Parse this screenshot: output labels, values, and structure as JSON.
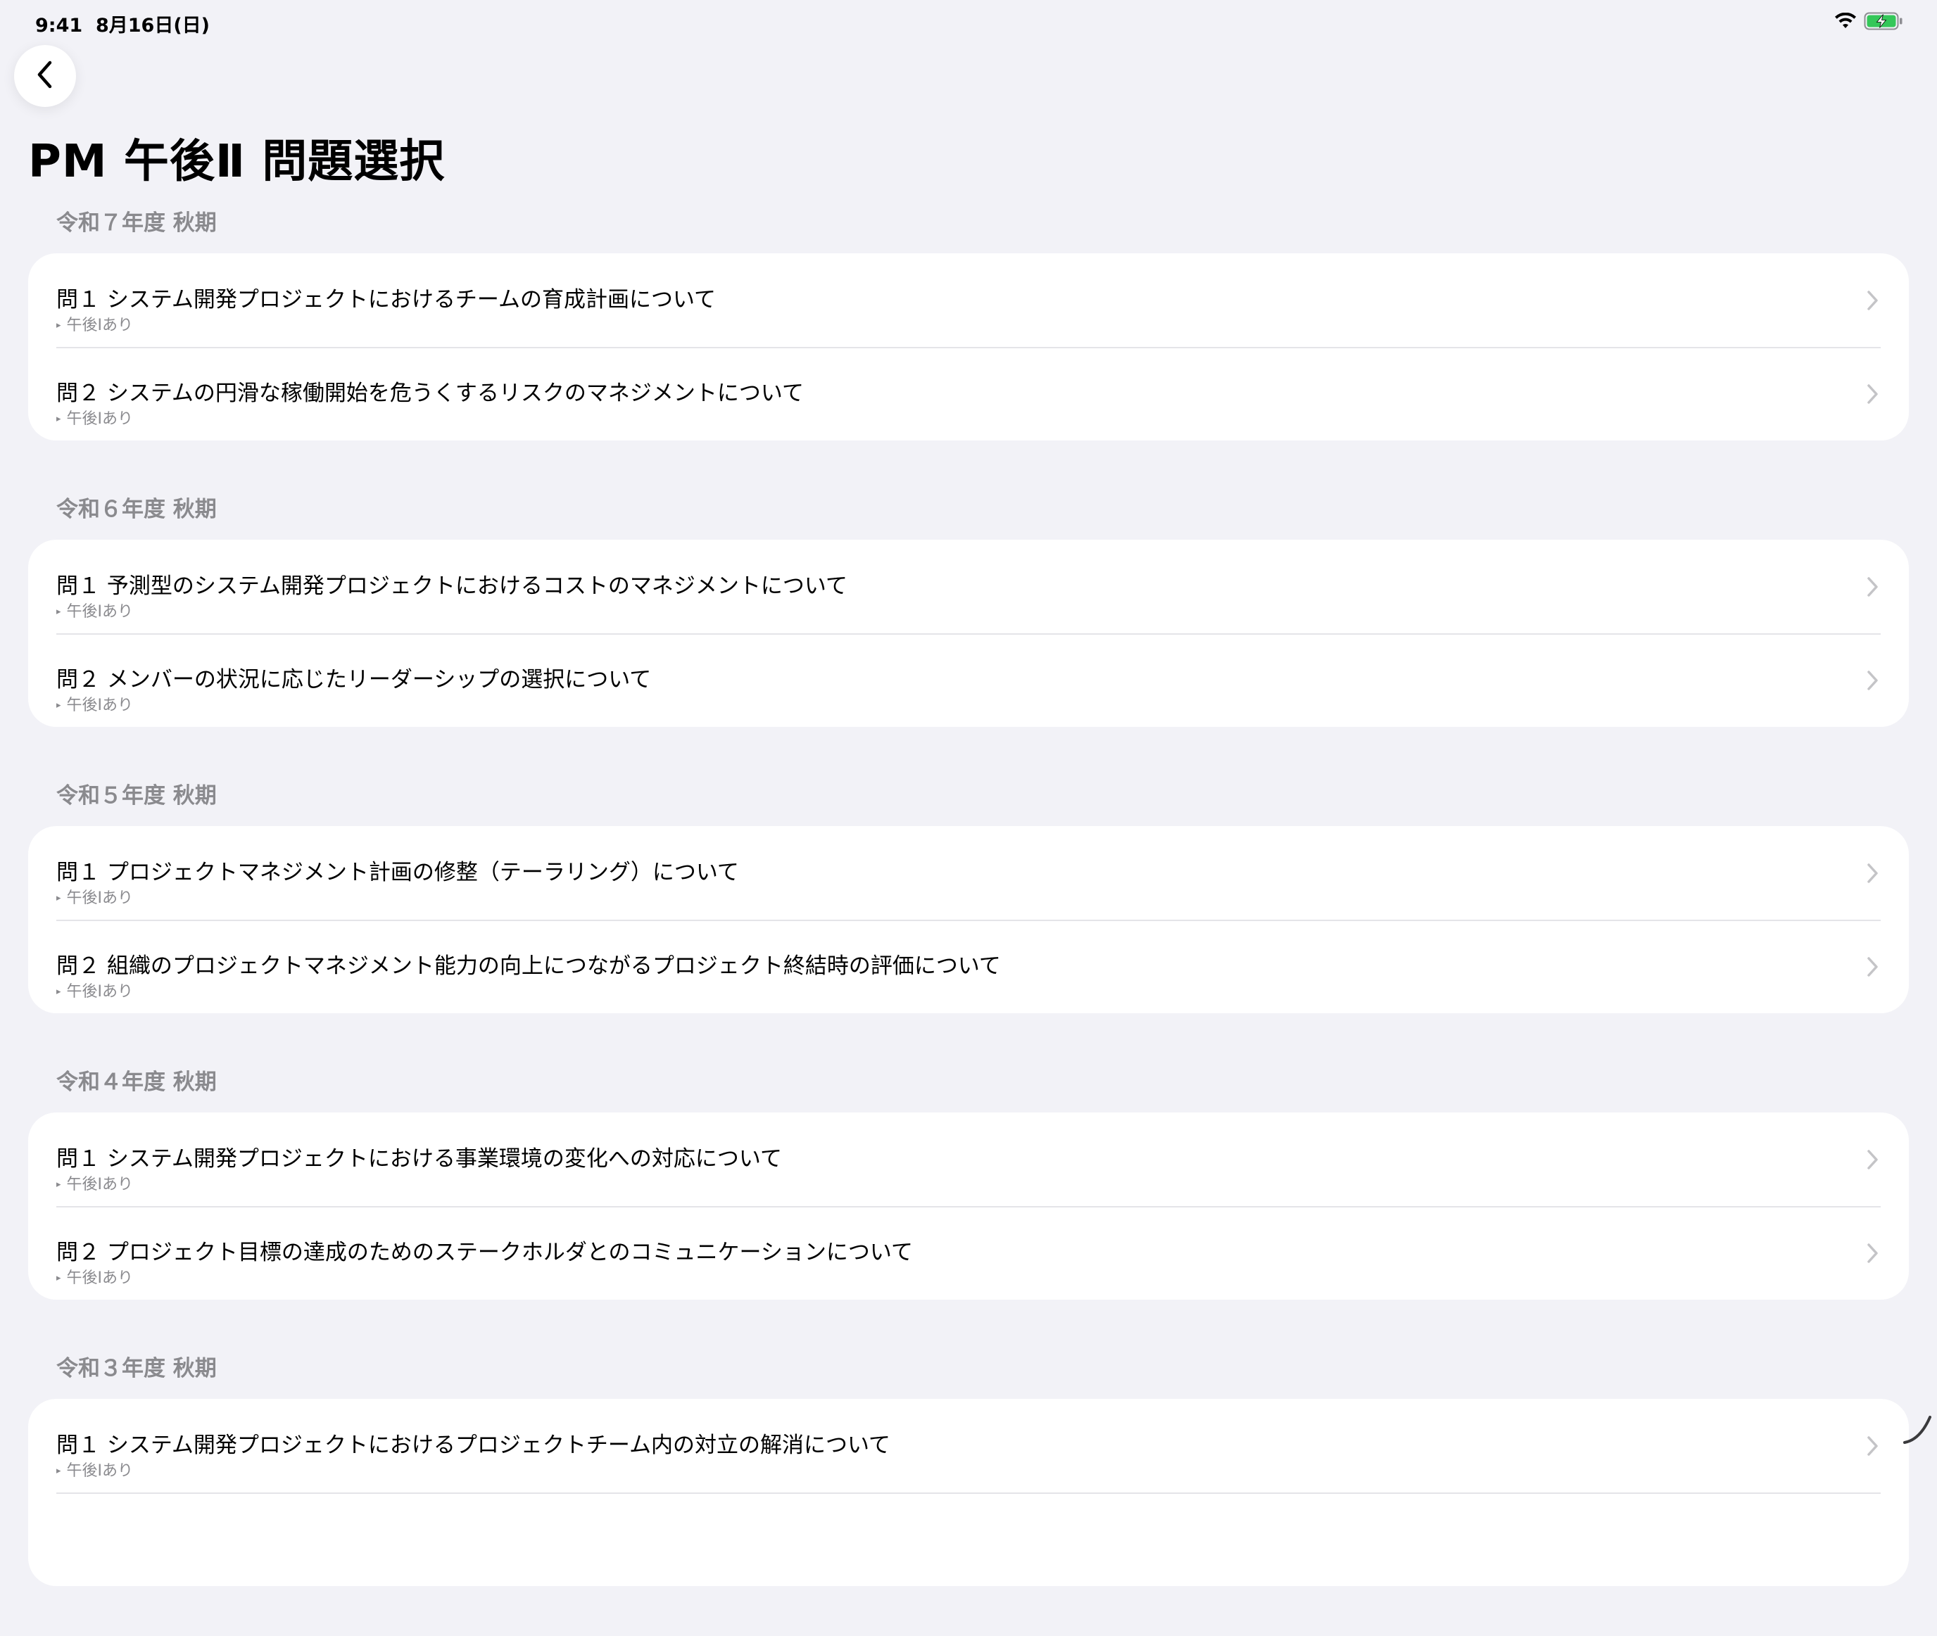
{
  "status_bar": {
    "time": "9:41",
    "date": "8月16日(日)"
  },
  "page": {
    "title": "PM 午後Ⅱ 問題選択"
  },
  "sections": [
    {
      "header": "令和７年度 秋期",
      "items": [
        {
          "title": "問１ システム開発プロジェクトにおけるチームの育成計画について",
          "subtitle": "午後Ⅰあり"
        },
        {
          "title": "問２ システムの円滑な稼働開始を危うくするリスクのマネジメントについて",
          "subtitle": "午後Ⅰあり"
        }
      ]
    },
    {
      "header": "令和６年度 秋期",
      "items": [
        {
          "title": "問１ 予測型のシステム開発プロジェクトにおけるコストのマネジメントについて",
          "subtitle": "午後Ⅰあり"
        },
        {
          "title": "問２ メンバーの状況に応じたリーダーシップの選択について",
          "subtitle": "午後Ⅰあり"
        }
      ]
    },
    {
      "header": "令和５年度 秋期",
      "items": [
        {
          "title": "問１ プロジェクトマネジメント計画の修整（テーラリング）について",
          "subtitle": "午後Ⅰあり"
        },
        {
          "title": "問２ 組織のプロジェクトマネジメント能力の向上につながるプロジェクト終結時の評価について",
          "subtitle": "午後Ⅰあり"
        }
      ]
    },
    {
      "header": "令和４年度 秋期",
      "items": [
        {
          "title": "問１ システム開発プロジェクトにおける事業環境の変化への対応について",
          "subtitle": "午後Ⅰあり"
        },
        {
          "title": "問２ プロジェクト目標の達成のためのステークホルダとのコミュニケーションについて",
          "subtitle": "午後Ⅰあり"
        }
      ]
    },
    {
      "header": "令和３年度 秋期",
      "items": [
        {
          "title": "問１ システム開発プロジェクトにおけるプロジェクトチーム内の対立の解消について",
          "subtitle": "午後Ⅰあり"
        },
        {
          "title": "",
          "subtitle": ""
        }
      ]
    }
  ],
  "icons": {
    "back": "chevron-left-icon",
    "row_disclosure": "chevron-right-icon",
    "wifi": "wifi-icon",
    "battery": "battery-charging-icon"
  },
  "colors": {
    "background": "#f2f2f7",
    "card": "#ffffff",
    "secondary_text": "#8a8a8e",
    "battery_fill": "#34c759"
  }
}
